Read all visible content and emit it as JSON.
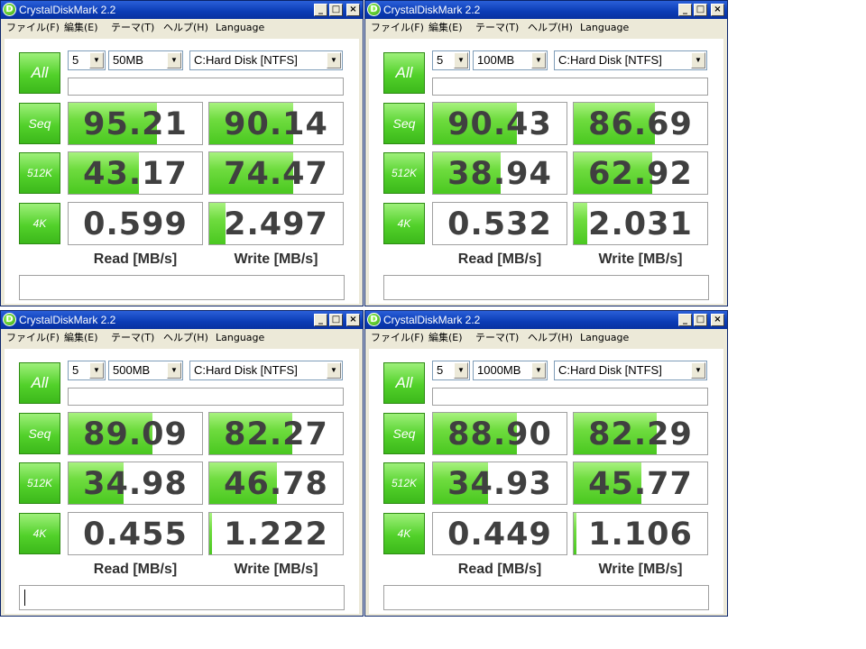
{
  "colors": {
    "accent_green": "#4ac820",
    "titlebar_blue": "#0a3bb5"
  },
  "windows": [
    {
      "title": "CrystalDiskMark 2.2",
      "menu": [
        "ファイル(F)",
        "編集(E)",
        "テーマ(T)",
        "ヘルプ(H)",
        "Language"
      ],
      "all_label": "All",
      "count": "5",
      "size": "50MB",
      "drive": "C:Hard Disk [NTFS]",
      "read_label": "Read [MB/s]",
      "write_label": "Write [MB/s]",
      "caret": false,
      "rows": [
        {
          "label": "Seq",
          "read": "95.21",
          "write": "90.14",
          "read_fill": 0.66,
          "write_fill": 0.63
        },
        {
          "label": "512K",
          "read": "43.17",
          "write": "74.47",
          "read_fill": 0.53,
          "write_fill": 0.63
        },
        {
          "label": "4K",
          "read": "0.599",
          "write": "2.497",
          "read_fill": 0.0,
          "write_fill": 0.12
        }
      ]
    },
    {
      "title": "CrystalDiskMark 2.2",
      "menu": [
        "ファイル(F)",
        "編集(E)",
        "テーマ(T)",
        "ヘルプ(H)",
        "Language"
      ],
      "all_label": "All",
      "count": "5",
      "size": "100MB",
      "drive": "C:Hard Disk [NTFS]",
      "read_label": "Read [MB/s]",
      "write_label": "Write [MB/s]",
      "caret": false,
      "rows": [
        {
          "label": "Seq",
          "read": "90.43",
          "write": "86.69",
          "read_fill": 0.63,
          "write_fill": 0.61
        },
        {
          "label": "512K",
          "read": "38.94",
          "write": "62.92",
          "read_fill": 0.51,
          "write_fill": 0.59
        },
        {
          "label": "4K",
          "read": "0.532",
          "write": "2.031",
          "read_fill": 0.0,
          "write_fill": 0.1
        }
      ]
    },
    {
      "title": "CrystalDiskMark 2.2",
      "menu": [
        "ファイル(F)",
        "編集(E)",
        "テーマ(T)",
        "ヘルプ(H)",
        "Language"
      ],
      "all_label": "All",
      "count": "5",
      "size": "500MB",
      "drive": "C:Hard Disk [NTFS]",
      "read_label": "Read [MB/s]",
      "write_label": "Write [MB/s]",
      "caret": true,
      "rows": [
        {
          "label": "Seq",
          "read": "89.09",
          "write": "82.27",
          "read_fill": 0.63,
          "write_fill": 0.62
        },
        {
          "label": "512K",
          "read": "34.98",
          "write": "46.78",
          "read_fill": 0.41,
          "write_fill": 0.51
        },
        {
          "label": "4K",
          "read": "0.455",
          "write": "1.222",
          "read_fill": 0.0,
          "write_fill": 0.02
        }
      ]
    },
    {
      "title": "CrystalDiskMark 2.2",
      "menu": [
        "ファイル(F)",
        "編集(E)",
        "テーマ(T)",
        "ヘルプ(H)",
        "Language"
      ],
      "all_label": "All",
      "count": "5",
      "size": "1000MB",
      "drive": "C:Hard Disk [NTFS]",
      "read_label": "Read [MB/s]",
      "write_label": "Write [MB/s]",
      "caret": false,
      "rows": [
        {
          "label": "Seq",
          "read": "88.90",
          "write": "82.29",
          "read_fill": 0.63,
          "write_fill": 0.62
        },
        {
          "label": "512K",
          "read": "34.93",
          "write": "45.77",
          "read_fill": 0.41,
          "write_fill": 0.51
        },
        {
          "label": "4K",
          "read": "0.449",
          "write": "1.106",
          "read_fill": 0.0,
          "write_fill": 0.02
        }
      ]
    }
  ]
}
